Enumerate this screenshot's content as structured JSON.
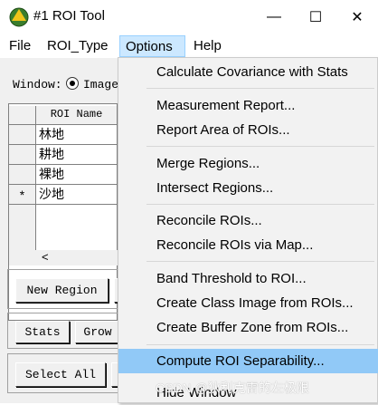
{
  "window": {
    "title": "#1 ROI Tool",
    "controls": {
      "minimize": "—",
      "maximize": "☐",
      "close": "✕"
    }
  },
  "menubar": {
    "items": [
      "File",
      "ROI_Type",
      "Options",
      "Help"
    ]
  },
  "dialog": {
    "window_label": "Window:",
    "radio_label": "Image",
    "table": {
      "header": "ROI Name",
      "rows": [
        {
          "marker": "",
          "name": "林地"
        },
        {
          "marker": "",
          "name": "耕地"
        },
        {
          "marker": "",
          "name": "裸地"
        },
        {
          "marker": "*",
          "name": "沙地"
        }
      ]
    },
    "scroll_left": "<",
    "buttons": {
      "new_region": "New Region",
      "stats": "Stats",
      "grow": "Grow",
      "select_all": "Select All"
    }
  },
  "options_menu": {
    "items": [
      "Calculate Covariance with Stats",
      "Measurement Report...",
      "Report Area of ROIs...",
      "Merge Regions...",
      "Intersect Regions...",
      "Reconcile ROIs...",
      "Reconcile ROIs via Map...",
      "Band Threshold to ROI...",
      "Create Class Image from ROIs...",
      "Create Buffer Zone from ROIs...",
      "Compute ROI Separability...",
      "Hide Window"
    ],
    "highlighted": "Compute ROI Separability..."
  },
  "watermark": "CSDN @狄利克雷的左极限",
  "colors": {
    "menu_highlight": "#91c9f7",
    "menu_bar_selected": "#cce8ff"
  }
}
